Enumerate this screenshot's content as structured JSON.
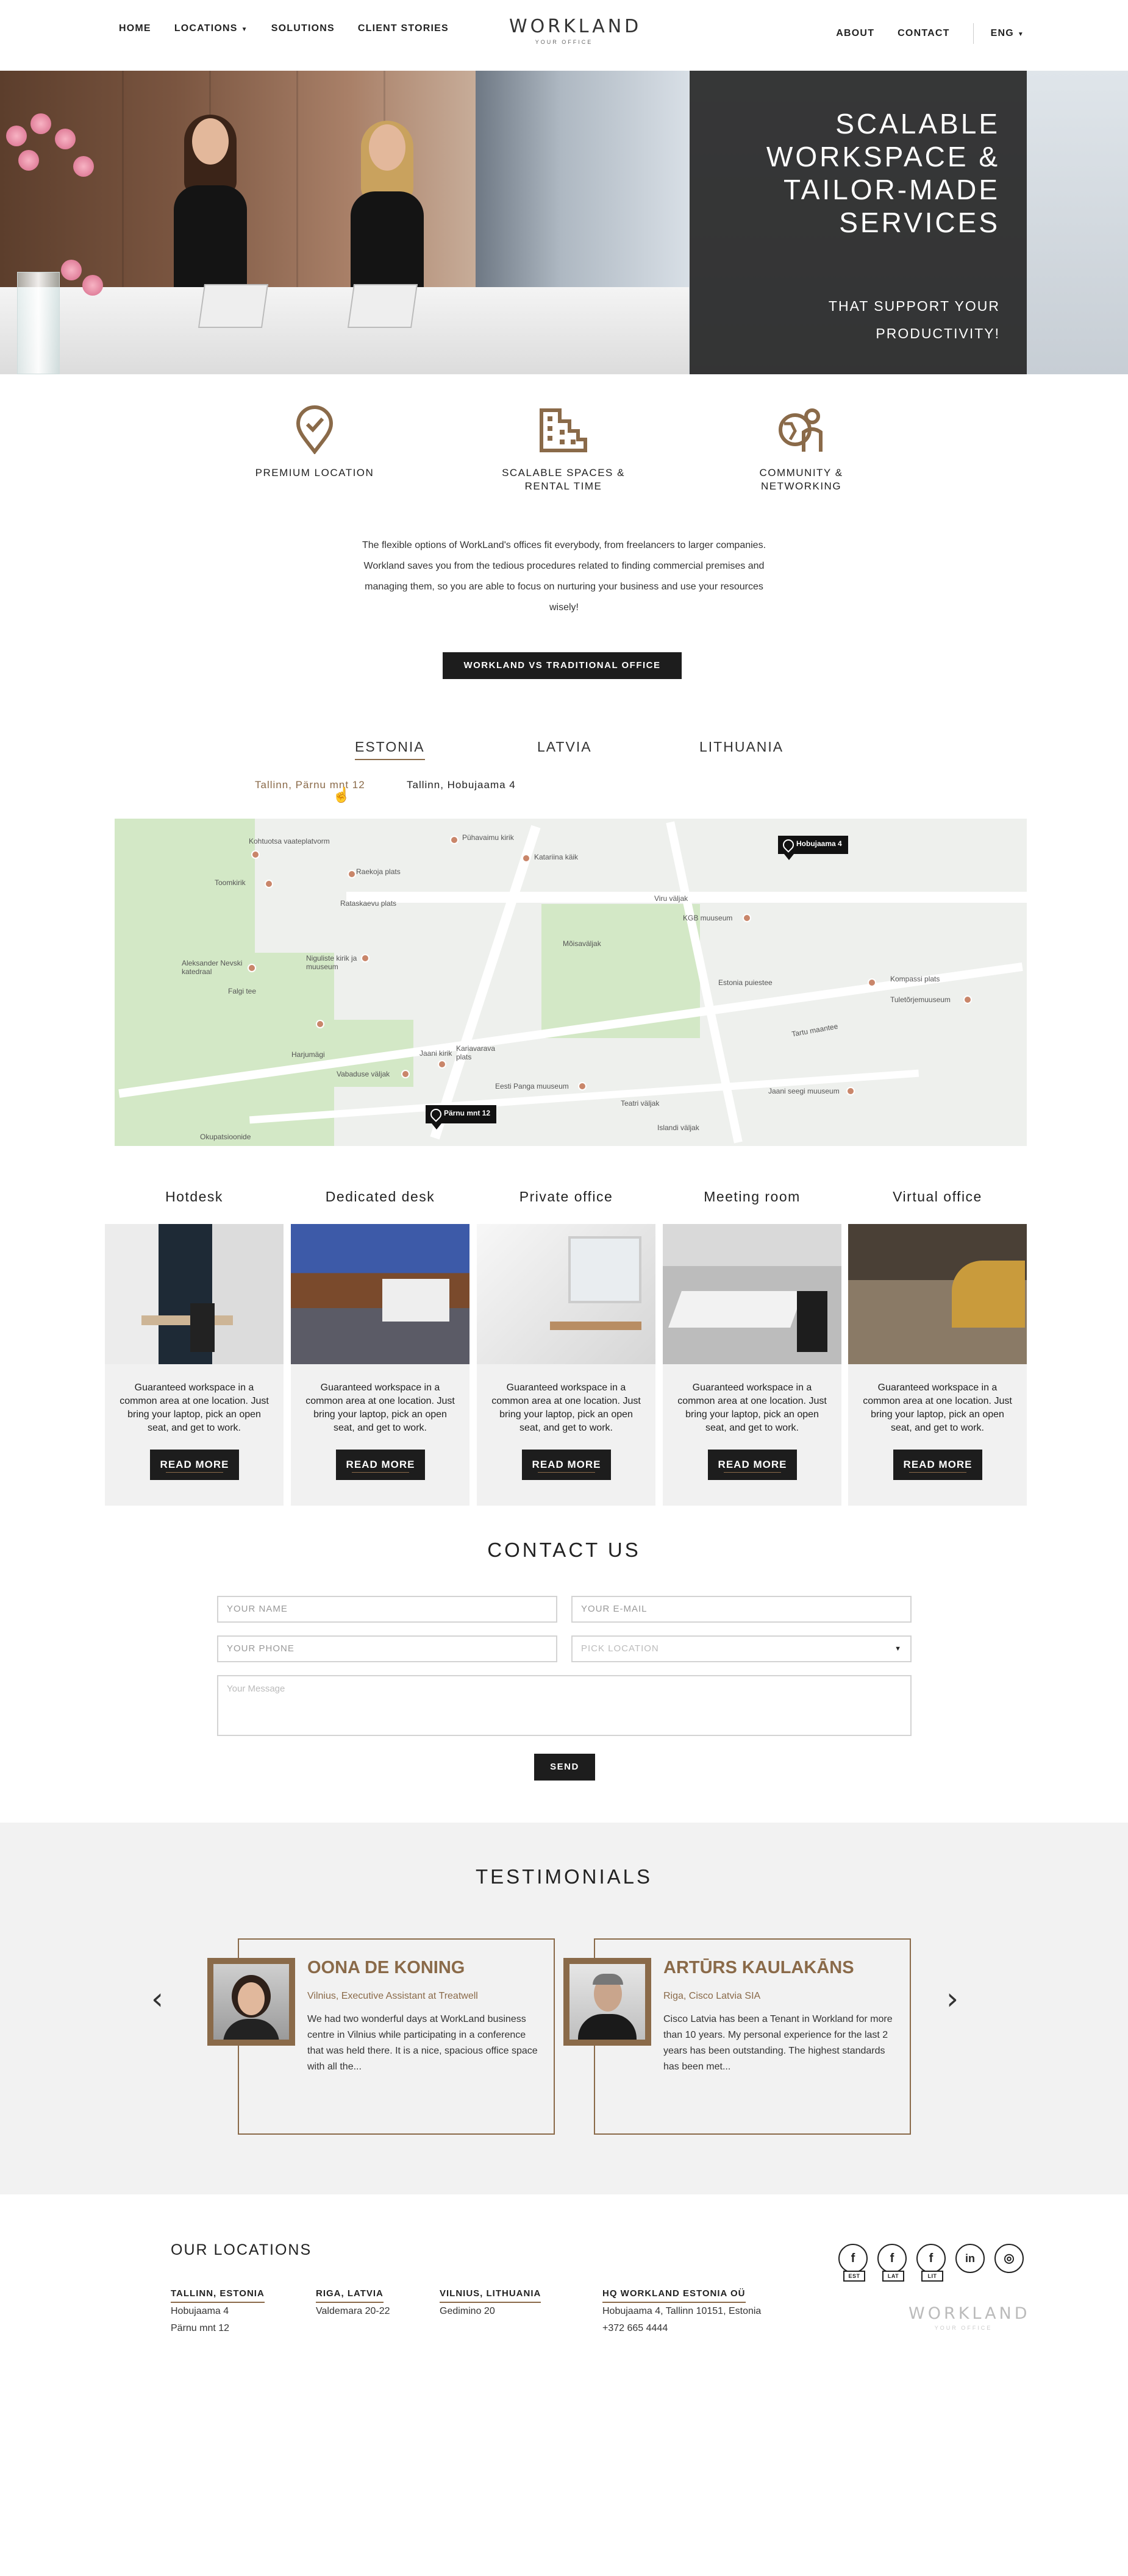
{
  "header": {
    "nav_left": [
      "HOME",
      "LOCATIONS",
      "SOLUTIONS",
      "CLIENT STORIES"
    ],
    "logo": "WORKLAND",
    "logo_sub": "YOUR OFFICE",
    "nav_right": [
      "ABOUT",
      "CONTACT"
    ],
    "language": "ENG"
  },
  "hero": {
    "title_lines": [
      "SCALABLE",
      "WORKSPACE &",
      "TAILOR-MADE",
      "SERVICES"
    ],
    "sub_lines": [
      "THAT SUPPORT YOUR",
      "PRODUCTIVITY!"
    ]
  },
  "features": [
    {
      "label_lines": [
        "PREMIUM LOCATION",
        ""
      ],
      "icon": "location-check-icon"
    },
    {
      "label_lines": [
        "SCALABLE SPACES &",
        "RENTAL TIME"
      ],
      "icon": "buildings-icon"
    },
    {
      "label_lines": [
        "COMMUNITY &",
        "NETWORKING"
      ],
      "icon": "community-globe-icon"
    }
  ],
  "intro_text": "The flexible options of WorkLand's offices fit everybody, from freelancers to larger companies. Workland saves you from the tedious procedures related to finding commercial premises and managing them, so you are able to focus on nurturing your business and use your resources wisely!",
  "compare_button": "WORKLAND VS TRADITIONAL OFFICE",
  "countries": {
    "tabs": [
      "ESTONIA",
      "LATVIA",
      "LITHUANIA"
    ],
    "active": "ESTONIA",
    "locations": [
      "Tallinn, Pärnu mnt 12",
      "Tallinn, Hobujaama 4"
    ],
    "active_location": "Tallinn, Pärnu mnt 12"
  },
  "map": {
    "markers": [
      "Hobujaama 4",
      "Pärnu mnt 12"
    ],
    "labels": [
      "Kohtuotsa vaateplatvorm",
      "Toomkirik",
      "Raekoja plats",
      "Rataskaevu plats",
      "Aleksander Nevski katedraal",
      "Niguliste kirik ja muuseum",
      "Falgi tee",
      "Harjumägi",
      "Vabaduse väljak",
      "Jaani kirik",
      "Kariavarava plats",
      "Okupatsioonide",
      "Pühavaimu kirik",
      "Katariina käik",
      "Viru väljak",
      "KGB muuseum",
      "Kompassi plats",
      "Tuletõrjemuuseum",
      "Jaani seegi muuseum",
      "Eesti Panga muuseum",
      "Tartu maantee",
      "Estonia puiestee",
      "Mõisaväljak",
      "Islandi väljak",
      "Teatri väljak"
    ]
  },
  "offices": [
    {
      "title": "Hotdesk",
      "text": "Guaranteed workspace in a common area at one location. Just bring your laptop, pick an open seat, and get to work.",
      "button": "READ MORE"
    },
    {
      "title": "Dedicated desk",
      "text": "Guaranteed workspace in a common area at one location. Just bring your laptop, pick an open seat, and get to work.",
      "button": "READ MORE"
    },
    {
      "title": "Private office",
      "text": "Guaranteed workspace in a common area at one location. Just bring your laptop, pick an open seat, and get to work.",
      "button": "READ MORE"
    },
    {
      "title": "Meeting room",
      "text": "Guaranteed workspace in a common area at one location. Just bring your laptop, pick an open seat, and get to work.",
      "button": "READ MORE"
    },
    {
      "title": "Virtual office",
      "text": "Guaranteed workspace in a common area at one location. Just bring your laptop, pick an open seat, and get to work.",
      "button": "READ MORE"
    }
  ],
  "contact": {
    "title": "CONTACT US",
    "name_placeholder": "YOUR NAME",
    "email_placeholder": "YOUR E-MAIL",
    "phone_placeholder": "YOUR PHONE",
    "location_placeholder": "PICK LOCATION",
    "message_placeholder": "Your Message",
    "send": "SEND"
  },
  "testimonials": {
    "title": "TESTIMONIALS",
    "items": [
      {
        "name": "OONA DE KONING",
        "role": "Vilnius, Executive Assistant at Treatwell",
        "quote": "We had two wonderful days at WorkLand business centre in Vilnius while participating in a conference that was held there. It is a nice, spacious office space with all the..."
      },
      {
        "name": "ARTŪRS KAULAKĀNS",
        "role": "Riga, Cisco Latvia SIA",
        "quote": "Cisco Latvia has been a Tenant in Workland for more than 10 years. My personal experience for the last 2 years has been outstanding. The highest standards has been met..."
      }
    ]
  },
  "footer": {
    "title": "OUR LOCATIONS",
    "columns": [
      {
        "heading": "TALLINN, ESTONIA",
        "lines": [
          "Hobujaama 4",
          "Pärnu mnt 12"
        ]
      },
      {
        "heading": "RIGA, LATVIA",
        "lines": [
          "Valdemara 20-22"
        ]
      },
      {
        "heading": "VILNIUS, LITHUANIA",
        "lines": [
          "Gedimino 20"
        ]
      },
      {
        "heading": "HQ WORKLAND ESTONIA OÜ",
        "lines": [
          "Hobujaama 4, Tallinn 10151, Estonia",
          "+372 665 4444"
        ]
      }
    ],
    "social": [
      {
        "glyph": "f",
        "tag": "EST"
      },
      {
        "glyph": "f",
        "tag": "LAT"
      },
      {
        "glyph": "f",
        "tag": "LIT"
      },
      {
        "glyph": "in",
        "tag": ""
      },
      {
        "glyph": "◎",
        "tag": ""
      }
    ],
    "logo": "WORKLAND",
    "logo_sub": "YOUR OFFICE"
  },
  "colors": {
    "accent": "#8a6a49",
    "dark": "#1d1d1d",
    "band": "#f2f2f2"
  }
}
